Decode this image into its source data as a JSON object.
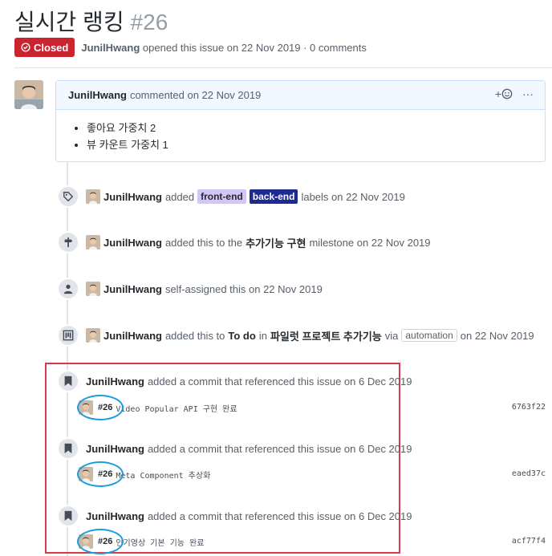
{
  "issue": {
    "title": "실시간 랭킹",
    "number": "#26",
    "status": "Closed",
    "author": "JunilHwang",
    "opened_text": "opened this issue on 22 Nov 2019 · 0 comments"
  },
  "comment": {
    "author": "JunilHwang",
    "meta": "commented on 22 Nov 2019",
    "reaction_label": "+",
    "more_label": "···",
    "items": [
      "좋아요 가중치 2",
      "뷰 카운트 가중치 1"
    ]
  },
  "events": {
    "labels": {
      "user": "JunilHwang",
      "prefix": "added",
      "label1": "front-end",
      "label2": "back-end",
      "suffix": "labels on 22 Nov 2019"
    },
    "milestone": {
      "user": "JunilHwang",
      "prefix": "added this to the",
      "milestone": "추가기능 구현",
      "suffix": "milestone on 22 Nov 2019"
    },
    "assigned": {
      "user": "JunilHwang",
      "text": "self-assigned this on 22 Nov 2019"
    },
    "project": {
      "user": "JunilHwang",
      "prefix": "added this to",
      "column": "To do",
      "in": "in",
      "project": "파일럿 프로젝트 추가기능",
      "via": "via",
      "automation": "automation",
      "suffix": "on 22 Nov 2019"
    }
  },
  "commits": [
    {
      "user": "JunilHwang",
      "text": "added a commit that referenced this issue on 6 Dec 2019",
      "ref": "#26",
      "message": "Video Popular API 구현 완료",
      "sha": "6763f22"
    },
    {
      "user": "JunilHwang",
      "text": "added a commit that referenced this issue on 6 Dec 2019",
      "ref": "#26",
      "message": "Meta Component 추상화",
      "sha": "eaed37c"
    },
    {
      "user": "JunilHwang",
      "text": "added a commit that referenced this issue on 6 Dec 2019",
      "ref": "#26",
      "message": "인기영상 기본 기능 완료",
      "sha": "acf77f4"
    }
  ],
  "colors": {
    "closed": "#cb2431",
    "highlight_box": "#d73a49",
    "highlight_oval": "#1a9ee0",
    "label_frontend": "#d4c5f9",
    "label_backend": "#1d2b91"
  }
}
